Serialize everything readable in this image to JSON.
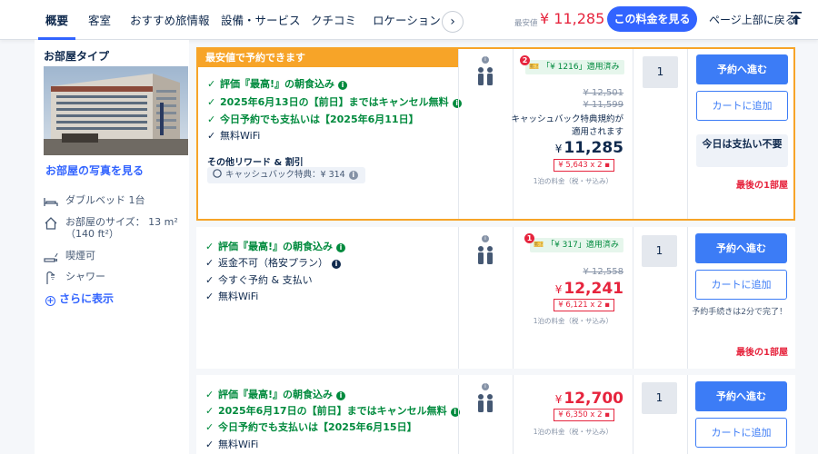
{
  "nav": {
    "tabs": [
      "概要",
      "客室",
      "おすすめ旅情報",
      "設備・サービス",
      "クチコミ",
      "ロケーション"
    ],
    "lowest_label": "最安値",
    "lowest_price": "¥ 11,285",
    "see_price_button": "この料金を見る",
    "back_to_top": "ページ上部に戻る"
  },
  "room": {
    "type_title": "お部屋タイプ",
    "photo_link": "お部屋の写真を見る",
    "amenities": [
      {
        "icon": "bed-icon",
        "label": "ダブルベッド 1台"
      },
      {
        "icon": "house-icon",
        "label": "お部屋のサイズ： 13 m²（140 ft²）"
      },
      {
        "icon": "smoking-icon",
        "label": "喫煙可"
      },
      {
        "icon": "shower-icon",
        "label": "シャワー"
      }
    ],
    "more_link": "さらに表示"
  },
  "rates": [
    {
      "ribbon": "最安値で予約できます",
      "features": [
        {
          "text": "評価『最高!』の朝食込み",
          "green": true,
          "info": true
        },
        {
          "text": "2025年6月13日の【前日】まではキャンセル無料",
          "green": true,
          "info": true
        },
        {
          "text": "今日予約でも支払いは【2025年6月11日】",
          "green": true,
          "info": false
        },
        {
          "text": "無料WiFi",
          "green": false,
          "info": false
        }
      ],
      "reward_title": "その他リワード & 割引",
      "reward_chip": "キャッシュバック特典：¥ 314",
      "cashback_badge_count": "2",
      "cashback_tag": "「¥ 1216」適用済み",
      "strike_prices": [
        "¥ 12,501",
        "¥ 11,599"
      ],
      "cashback_note": "キャッシュバック特典規約が適用されます",
      "price": "11,285",
      "price_currency": "¥",
      "per_night_box": "¥ 5,643 x 2",
      "tax_note": "1泊の料金（税・サ込み）",
      "quantity": "1",
      "reserve_label": "予約へ進む",
      "cart_label": "カートに追加",
      "pay_later": "今日は支払い不要",
      "last_room": "最後の1部屋"
    },
    {
      "features": [
        {
          "text": "評価『最高!』の朝食込み",
          "green": true,
          "info": true
        },
        {
          "text": "返金不可（格安プラン）",
          "green": false,
          "info": true
        },
        {
          "text": "今すぐ予約 & 支払い",
          "green": false,
          "info": false
        },
        {
          "text": "無料WiFi",
          "green": false,
          "info": false
        }
      ],
      "cashback_badge_count": "1",
      "cashback_tag": "「¥ 317」適用済み",
      "strike_prices": [
        "¥ 12,558"
      ],
      "price": "12,241",
      "price_currency": "¥",
      "per_night_box": "¥ 6,121 x 2",
      "tax_note": "1泊の料金（税・サ込み）",
      "quantity": "1",
      "reserve_label": "予約へ進む",
      "cart_label": "カートに追加",
      "quick_note": "予約手続きは2分で完了！",
      "last_room": "最後の1部屋"
    },
    {
      "features": [
        {
          "text": "評価『最高!』の朝食込み",
          "green": true,
          "info": true
        },
        {
          "text": "2025年6月17日の【前日】まではキャンセル無料",
          "green": true,
          "info": true
        },
        {
          "text": "今日予約でも支払いは【2025年6月15日】",
          "green": true,
          "info": false
        },
        {
          "text": "無料WiFi",
          "green": false,
          "info": false
        }
      ],
      "price": "12,700",
      "price_currency": "¥",
      "per_night_box": "¥ 6,350 x 2",
      "tax_note": "1泊の料金（税・サ込み）",
      "quantity": "1",
      "reserve_label": "予約へ進む",
      "cart_label": "カートに追加"
    }
  ],
  "colors": {
    "accent": "#3264ff",
    "price_red": "#e6243d",
    "best_orange": "#f7a428",
    "green": "#008a3d"
  }
}
